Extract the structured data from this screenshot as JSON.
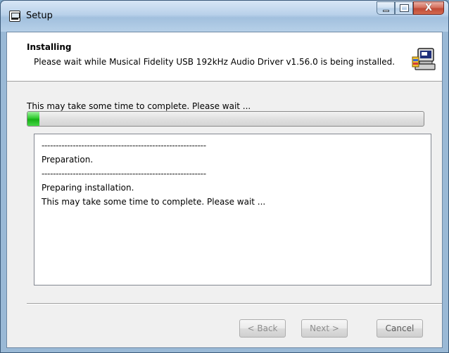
{
  "window": {
    "title": "Setup"
  },
  "caption": {
    "min": "–",
    "max": "□",
    "close": "X"
  },
  "header": {
    "title": "Installing",
    "subtitle": "Please wait while Musical Fidelity USB 192kHz Audio Driver v1.56.0 is being installed.",
    "icon": "installer-computer-icon"
  },
  "progress": {
    "label": "This may take some time to complete. Please wait ...",
    "value_percent": 3,
    "color": "#22bb22"
  },
  "log": {
    "lines": [
      "----------------------------------------------------------",
      "Preparation.",
      "----------------------------------------------------------",
      "Preparing installation.",
      "This may take some time to complete. Please wait ..."
    ]
  },
  "buttons": {
    "back": "< Back",
    "next": "Next >",
    "cancel": "Cancel"
  }
}
